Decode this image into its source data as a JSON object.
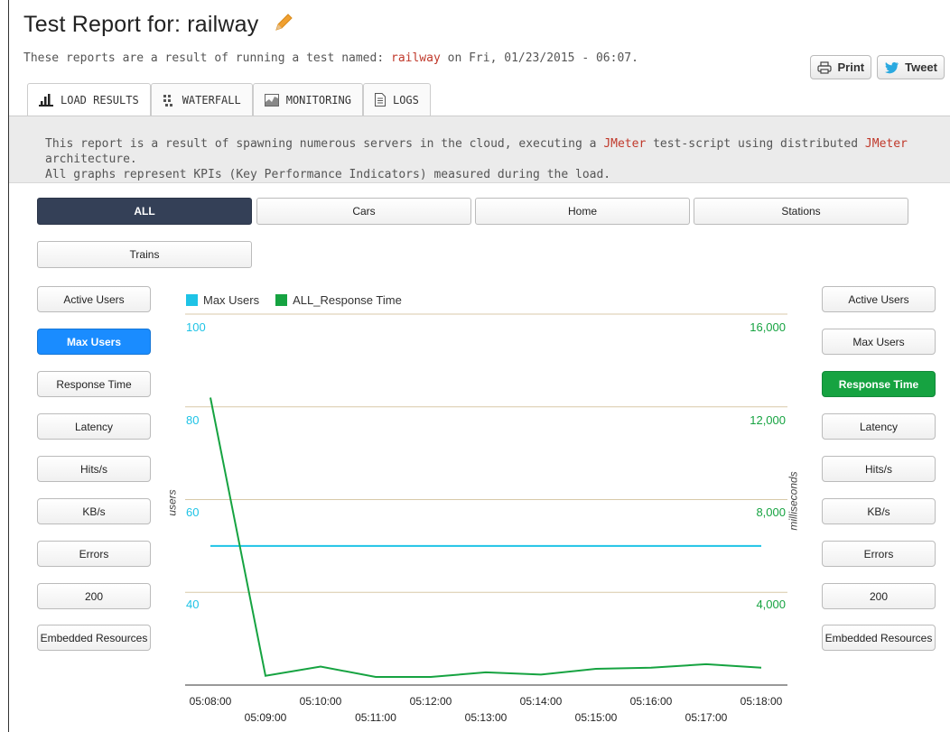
{
  "header": {
    "title": "Test Report for: railway",
    "subtitle_before": "These reports are a result of running a test named: ",
    "test_name": "railway",
    "subtitle_after": " on Fri, 01/23/2015 - 06:07."
  },
  "share": {
    "print": "Print",
    "tweet": "Tweet"
  },
  "tabs": [
    {
      "label": "LOAD RESULTS",
      "icon": "bar-chart-icon"
    },
    {
      "label": "WATERFALL",
      "icon": "grid-dots-icon"
    },
    {
      "label": "MONITORING",
      "icon": "area-chart-icon"
    },
    {
      "label": "LOGS",
      "icon": "document-icon"
    }
  ],
  "info": {
    "p1": "This report is a result of spawning numerous servers in the cloud, executing a ",
    "k1": "JMeter",
    "p2": " test-script using distributed ",
    "k2": "JMeter",
    "p3": " architecture.",
    "line2": "All graphs represent KPIs (Key Performance Indicators) measured during the load."
  },
  "segments": [
    "ALL",
    "Cars",
    "Home",
    "Stations",
    "Trains"
  ],
  "left_metrics": [
    "Active Users",
    "Max Users",
    "Response Time",
    "Latency",
    "Hits/s",
    "KB/s",
    "Errors",
    "200",
    "Embedded Resources"
  ],
  "right_metrics": [
    "Active Users",
    "Max Users",
    "Response Time",
    "Latency",
    "Hits/s",
    "KB/s",
    "Errors",
    "200",
    "Embedded Resources"
  ],
  "colors": {
    "max_users": "#1ec3e6",
    "response_time": "#16a341",
    "accent": "#c0392b",
    "active_segment": "#344057",
    "active_blue": "#1a8cff"
  },
  "chart_data": {
    "type": "line",
    "legend": [
      "Max Users",
      "ALL_Response Time"
    ],
    "ylabel_left": "users",
    "ylabel_right": "milliseconds",
    "y_left_ticks": [
      "100",
      "80",
      "60",
      "40"
    ],
    "y_right_ticks": [
      "16,000",
      "12,000",
      "8,000",
      "4,000"
    ],
    "ylim_left": [
      20,
      100
    ],
    "ylim_right": [
      0,
      16000
    ],
    "x_ticks": [
      "05:08:00",
      "05:09:00",
      "05:10:00",
      "05:11:00",
      "05:12:00",
      "05:13:00",
      "05:14:00",
      "05:15:00",
      "05:16:00",
      "05:17:00",
      "05:18:00"
    ],
    "series": [
      {
        "name": "Max Users",
        "axis": "left",
        "x": [
          "05:08:00",
          "05:18:00"
        ],
        "values": [
          50,
          50
        ]
      },
      {
        "name": "ALL_Response Time",
        "axis": "right",
        "x": [
          "05:08:00",
          "05:09:00",
          "05:10:00",
          "05:11:00",
          "05:12:00",
          "05:13:00",
          "05:14:00",
          "05:15:00",
          "05:16:00",
          "05:17:00",
          "05:18:00"
        ],
        "values": [
          12400,
          400,
          800,
          350,
          350,
          550,
          450,
          700,
          750,
          900,
          750
        ]
      }
    ]
  }
}
